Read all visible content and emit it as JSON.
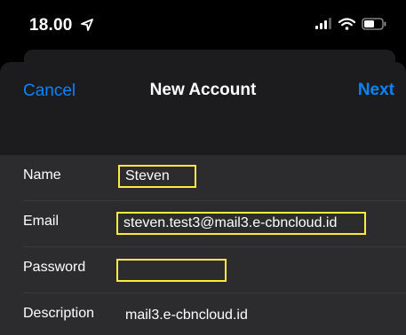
{
  "status": {
    "time": "18.00"
  },
  "nav": {
    "cancel_label": "Cancel",
    "title": "New Account",
    "next_label": "Next"
  },
  "form": {
    "name": {
      "label": "Name",
      "value": "Steven"
    },
    "email": {
      "label": "Email",
      "value": "steven.test3@mail3.e-cbncloud.id"
    },
    "password": {
      "label": "Password",
      "value": ""
    },
    "description": {
      "label": "Description",
      "value": "mail3.e-cbncloud.id"
    }
  },
  "colors": {
    "accent": "#0a84ff",
    "highlight": "#ffeb3b",
    "sheet": "#1c1c1e",
    "form": "#2c2c2e"
  },
  "icons": [
    "location-arrow-icon",
    "signal-icon",
    "wifi-icon",
    "battery-icon"
  ]
}
